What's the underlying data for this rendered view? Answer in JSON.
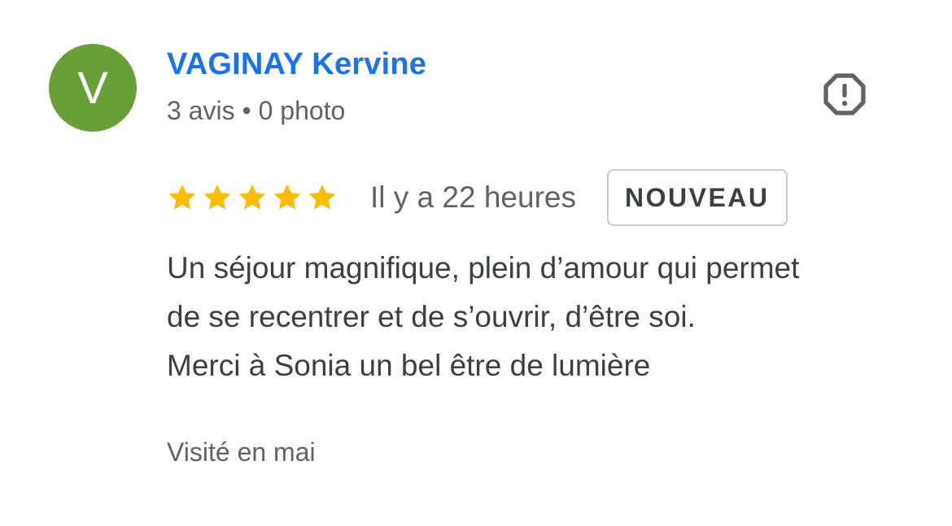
{
  "review": {
    "author": {
      "initial": "V",
      "name": "VAGINAY Kervine",
      "meta": "3 avis • 0 photo",
      "avatar_color": "#689f38"
    },
    "report_icon": "report-flag-octagon-icon",
    "rating": 5,
    "rating_max": 5,
    "time_ago": "Il y a 22 heures",
    "badge": "NOUVEAU",
    "text_lines": [
      "Un séjour magnifique, plein d’amour qui permet",
      "de se recentrer et de s’ouvrir, d’être soi.",
      "Merci à Sonia un bel être de lumière"
    ],
    "visit": "Visité en mai"
  },
  "colors": {
    "name_link": "#1a73e8",
    "star": "#fbbc04",
    "text": "#3c4043",
    "muted": "#5f6368"
  }
}
